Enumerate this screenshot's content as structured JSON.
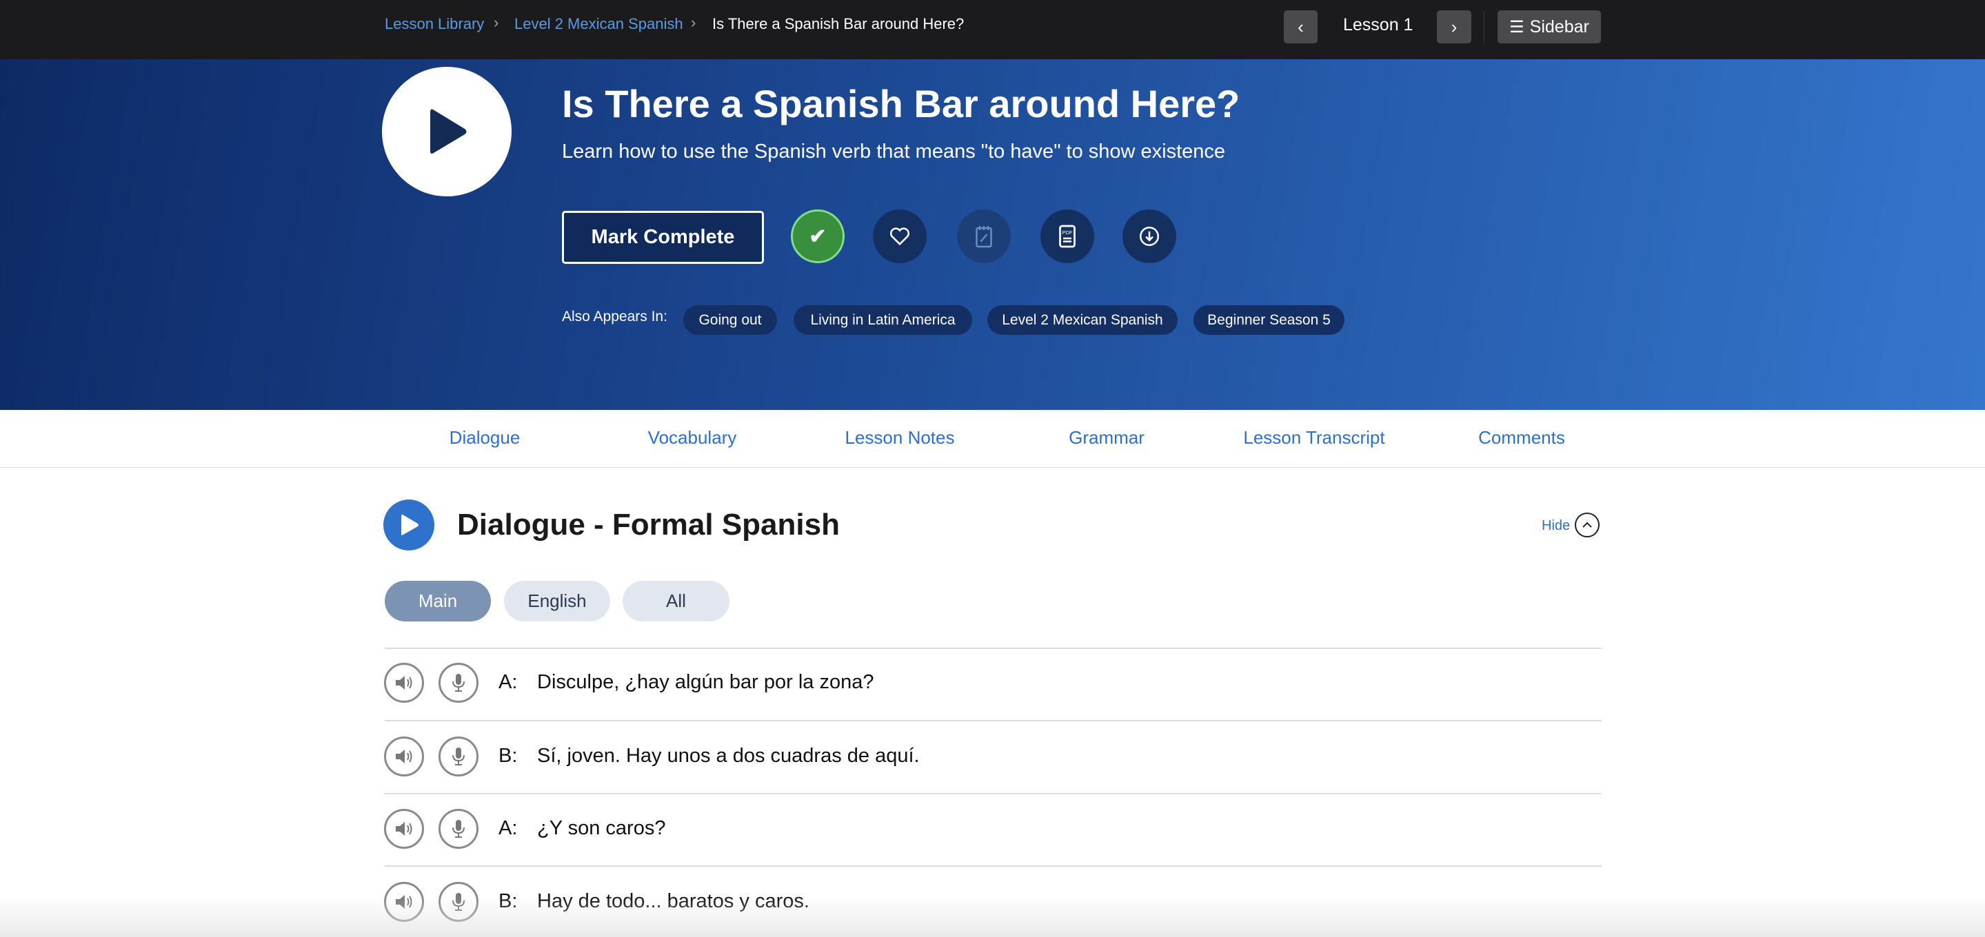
{
  "breadcrumb": [
    "Lesson Library",
    "Level 2 Mexican Spanish",
    "Is There a Spanish Bar around Here?"
  ],
  "nav": {
    "lesson_label": "Lesson 1",
    "sidebar_label": "Sidebar"
  },
  "hero": {
    "title": "Is There a Spanish Bar around Here?",
    "subtitle": "Learn how to use the Spanish verb that means \"to have\" to show existence",
    "mark_complete": "Mark Complete",
    "also_label": "Also Appears In:",
    "chips": [
      "Going out",
      "Living in Latin America",
      "Level 2 Mexican Spanish",
      "Beginner Season 5"
    ]
  },
  "tabs": [
    "Dialogue",
    "Vocabulary",
    "Lesson Notes",
    "Grammar",
    "Lesson Transcript",
    "Comments"
  ],
  "dialogue": {
    "title": "Dialogue - Formal Spanish",
    "hide": "Hide",
    "toggles": [
      "Main",
      "English",
      "All"
    ],
    "lines": [
      {
        "speaker": "A:",
        "text": "Disculpe, ¿hay algún bar por la zona?"
      },
      {
        "speaker": "B:",
        "text": "Sí, joven. Hay unos a dos cuadras de aquí."
      },
      {
        "speaker": "A:",
        "text": "¿Y son caros?"
      },
      {
        "speaker": "B:",
        "text": "Hay de todo... baratos y caros."
      }
    ]
  },
  "colors": {
    "accent": "#2e6fc8",
    "complete": "#3a8f3e"
  }
}
